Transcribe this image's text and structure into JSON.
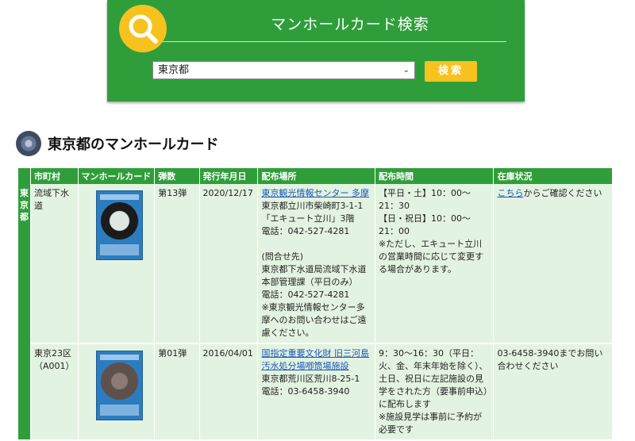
{
  "search": {
    "title": "マンホールカード検索",
    "selected": "東京都",
    "button": "検索",
    "accent": "#2f9e3a",
    "button_color": "#f7c21e"
  },
  "section": {
    "title": "東京都のマンホールカード",
    "icon": "manhole-icon"
  },
  "table": {
    "headers": [
      "",
      "市町村",
      "マンホールカード",
      "弾数",
      "発行年月日",
      "配布場所",
      "配布時間",
      "在庫状況"
    ],
    "pref_label": "東京都",
    "rows": [
      {
        "city": "流域下水道",
        "issue": "第13弾",
        "date": "2020/12/17",
        "place_link": "東京観光情報センター 多摩",
        "place_lines": [
          "東京都立川市柴崎町3-1-1",
          "「エキュート立川」3階",
          "電話：042-527-4281",
          "",
          "(問合せ先)",
          "東京都下水道局流域下水道本部管理課（平日のみ）",
          "電話：042-527-4281",
          "※東京観光情報センター多摩へのお問い合わせはご遠慮ください。"
        ],
        "time": "【平日・土】10：00～21：30\n【日・祝日】10：00～21：00\n※ただし、エキュート立川の営業時間に応じて変更する場合があります。",
        "stock_link": "こちら",
        "stock_text": "からご確認ください"
      },
      {
        "city": "東京23区\n（A001）",
        "issue": "第01弾",
        "date": "2016/04/01",
        "place_link": "国指定重要文化財 旧三河島汚水処分場喞筒場施設",
        "place_lines": [
          "東京都荒川区荒川8-25-1",
          "電話：03-6458-3940"
        ],
        "time": "9：30～16：30（平日：火、金、年末年始を除く）、土日、祝日に左記施設の見学をされた方（要事前申込）に配布します\n※施設見学は事前に予約が必要です",
        "stock_link": "",
        "stock_text": "03-6458-3940までお問い合わせください"
      }
    ]
  }
}
